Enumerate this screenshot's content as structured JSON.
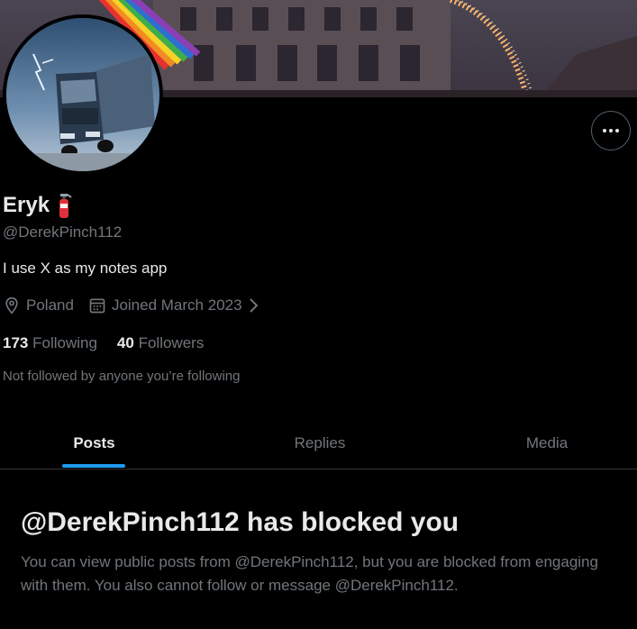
{
  "profile": {
    "name": "Eryk",
    "name_emoji": "fire-extinguisher-icon",
    "handle": "@DerekPinch112",
    "bio": "I use X as my notes app",
    "location": "Poland",
    "joined": "Joined March 2023",
    "following_count": "173",
    "following_label": "Following",
    "followers_count": "40",
    "followers_label": "Followers",
    "not_followed": "Not followed by anyone you’re following"
  },
  "tabs": [
    {
      "label": "Posts",
      "active": true
    },
    {
      "label": "Replies",
      "active": false
    },
    {
      "label": "Media",
      "active": false
    }
  ],
  "blocked": {
    "title": "@DerekPinch112 has blocked you",
    "body": "You can view public posts from @DerekPinch112, but you are blocked from engaging with them. You also cannot follow or message @DerekPinch112."
  },
  "colors": {
    "background": "#000000",
    "primary_text": "#e7e9ea",
    "secondary_text": "#71767b",
    "accent": "#1d9bf0",
    "border": "#2f3336"
  },
  "icons": {
    "more": "more-horizontal-icon",
    "location": "location-pin-icon",
    "calendar": "calendar-icon",
    "chevron": "chevron-right-icon"
  }
}
